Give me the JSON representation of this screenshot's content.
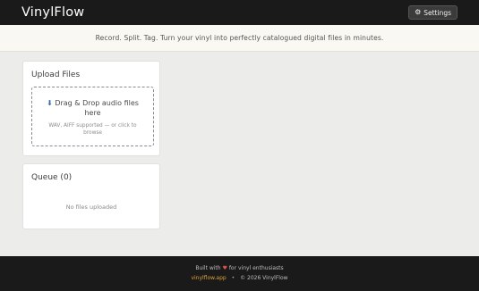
{
  "header": {
    "title": "VinylFlow",
    "settings_label": "Settings",
    "settings_icon": "gear-icon"
  },
  "tagline": "Record. Split. Tag. Turn your vinyl into perfectly catalogued digital files in minutes.",
  "upload": {
    "title": "Upload Files",
    "dropzone_icon": "upload-arrow-icon",
    "dropzone_text": "Drag & Drop audio files here",
    "dropzone_hint": "WAV, AIFF supported — or click to browse"
  },
  "queue": {
    "title": "Queue (0)",
    "empty_text": "No files uploaded"
  },
  "footer": {
    "built_prefix": "Built with",
    "built_suffix": "for vinyl enthusiasts",
    "link_text": "vinylflow.app",
    "separator": "•",
    "copyright": "© 2026 VinylFlow"
  },
  "colors": {
    "header_bg": "#1a1a1a",
    "page_bg": "#ececea",
    "tagline_bg": "#faf8f2",
    "link": "#d9a23a",
    "heart": "#e0534a",
    "upload_arrow": "#3b6ea8"
  }
}
